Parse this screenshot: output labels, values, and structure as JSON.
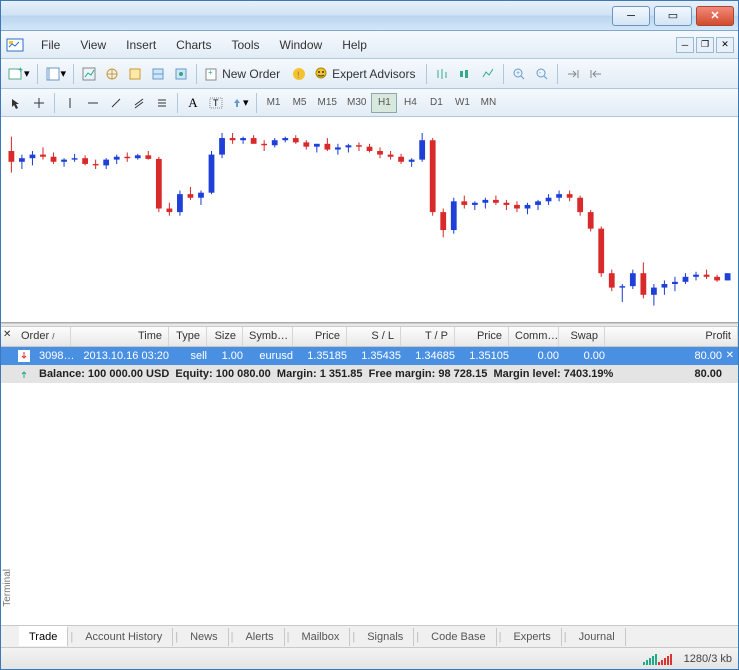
{
  "menu": {
    "file": "File",
    "view": "View",
    "insert": "Insert",
    "charts": "Charts",
    "tools": "Tools",
    "window": "Window",
    "help": "Help"
  },
  "toolbar": {
    "new_order": "New Order",
    "expert_advisors": "Expert Advisors"
  },
  "timeframes": [
    "M1",
    "M5",
    "M15",
    "M30",
    "H1",
    "H4",
    "D1",
    "W1",
    "MN"
  ],
  "active_timeframe": "H1",
  "terminal": {
    "label": "Terminal",
    "columns": {
      "order": "Order",
      "time": "Time",
      "type": "Type",
      "size": "Size",
      "symbol": "Symb…",
      "price": "Price",
      "sl": "S / L",
      "tp": "T / P",
      "price2": "Price",
      "comm": "Comm…",
      "swap": "Swap",
      "profit": "Profit"
    },
    "row": {
      "order": "3098…",
      "time": "2013.10.16 03:20",
      "type": "sell",
      "size": "1.00",
      "symbol": "eurusd",
      "price": "1.35185",
      "sl": "1.35435",
      "tp": "1.34685",
      "price2": "1.35105",
      "comm": "0.00",
      "swap": "0.00",
      "profit": "80.00"
    },
    "summary": {
      "balance_label": "Balance:",
      "balance": "100 000.00 USD",
      "equity_label": "Equity:",
      "equity": "100 080.00",
      "margin_label": "Margin:",
      "margin": "1 351.85",
      "free_margin_label": "Free margin:",
      "free_margin": "98 728.15",
      "margin_level_label": "Margin level:",
      "margin_level": "7403.19%",
      "profit": "80.00"
    },
    "tabs": [
      "Trade",
      "Account History",
      "News",
      "Alerts",
      "Mailbox",
      "Signals",
      "Code Base",
      "Experts",
      "Journal"
    ],
    "active_tab": "Trade"
  },
  "status": {
    "traffic": "1280/3 kb"
  },
  "chart_data": {
    "type": "candlestick",
    "timeframe": "H1",
    "symbol": "EURUSD",
    "candles": [
      {
        "o": 1.353,
        "h": 1.355,
        "l": 1.35,
        "c": 1.3515
      },
      {
        "o": 1.3515,
        "h": 1.3525,
        "l": 1.3505,
        "c": 1.352
      },
      {
        "o": 1.352,
        "h": 1.353,
        "l": 1.351,
        "c": 1.3525
      },
      {
        "o": 1.3525,
        "h": 1.3535,
        "l": 1.3518,
        "c": 1.3522
      },
      {
        "o": 1.3522,
        "h": 1.3528,
        "l": 1.3512,
        "c": 1.3515
      },
      {
        "o": 1.3515,
        "h": 1.352,
        "l": 1.3508,
        "c": 1.3518
      },
      {
        "o": 1.3518,
        "h": 1.3526,
        "l": 1.3515,
        "c": 1.352
      },
      {
        "o": 1.352,
        "h": 1.3524,
        "l": 1.351,
        "c": 1.3512
      },
      {
        "o": 1.3512,
        "h": 1.3518,
        "l": 1.3505,
        "c": 1.351
      },
      {
        "o": 1.351,
        "h": 1.352,
        "l": 1.3505,
        "c": 1.3518
      },
      {
        "o": 1.3518,
        "h": 1.3525,
        "l": 1.3512,
        "c": 1.3522
      },
      {
        "o": 1.3522,
        "h": 1.3528,
        "l": 1.3515,
        "c": 1.352
      },
      {
        "o": 1.352,
        "h": 1.3526,
        "l": 1.3518,
        "c": 1.3524
      },
      {
        "o": 1.3524,
        "h": 1.353,
        "l": 1.3518,
        "c": 1.3519
      },
      {
        "o": 1.3519,
        "h": 1.3522,
        "l": 1.3445,
        "c": 1.345
      },
      {
        "o": 1.345,
        "h": 1.3458,
        "l": 1.344,
        "c": 1.3445
      },
      {
        "o": 1.3445,
        "h": 1.3475,
        "l": 1.344,
        "c": 1.347
      },
      {
        "o": 1.347,
        "h": 1.348,
        "l": 1.3462,
        "c": 1.3465
      },
      {
        "o": 1.3465,
        "h": 1.3475,
        "l": 1.3455,
        "c": 1.3472
      },
      {
        "o": 1.3472,
        "h": 1.353,
        "l": 1.347,
        "c": 1.3525
      },
      {
        "o": 1.3525,
        "h": 1.3555,
        "l": 1.352,
        "c": 1.3548
      },
      {
        "o": 1.3548,
        "h": 1.3555,
        "l": 1.354,
        "c": 1.3545
      },
      {
        "o": 1.3545,
        "h": 1.355,
        "l": 1.354,
        "c": 1.3548
      },
      {
        "o": 1.3548,
        "h": 1.3552,
        "l": 1.3542,
        "c": 1.354
      },
      {
        "o": 1.354,
        "h": 1.3545,
        "l": 1.353,
        "c": 1.3538
      },
      {
        "o": 1.3538,
        "h": 1.3548,
        "l": 1.3535,
        "c": 1.3545
      },
      {
        "o": 1.3545,
        "h": 1.355,
        "l": 1.3542,
        "c": 1.3548
      },
      {
        "o": 1.3548,
        "h": 1.3552,
        "l": 1.354,
        "c": 1.3542
      },
      {
        "o": 1.3542,
        "h": 1.3545,
        "l": 1.3532,
        "c": 1.3536
      },
      {
        "o": 1.3536,
        "h": 1.354,
        "l": 1.3528,
        "c": 1.354
      },
      {
        "o": 1.354,
        "h": 1.3548,
        "l": 1.353,
        "c": 1.3532
      },
      {
        "o": 1.3532,
        "h": 1.354,
        "l": 1.3525,
        "c": 1.3535
      },
      {
        "o": 1.3535,
        "h": 1.354,
        "l": 1.3528,
        "c": 1.3538
      },
      {
        "o": 1.3538,
        "h": 1.3542,
        "l": 1.353,
        "c": 1.3536
      },
      {
        "o": 1.3536,
        "h": 1.354,
        "l": 1.3528,
        "c": 1.353
      },
      {
        "o": 1.353,
        "h": 1.3535,
        "l": 1.352,
        "c": 1.3525
      },
      {
        "o": 1.3525,
        "h": 1.353,
        "l": 1.3518,
        "c": 1.3522
      },
      {
        "o": 1.3522,
        "h": 1.3526,
        "l": 1.3512,
        "c": 1.3515
      },
      {
        "o": 1.3515,
        "h": 1.352,
        "l": 1.3508,
        "c": 1.3518
      },
      {
        "o": 1.3518,
        "h": 1.3555,
        "l": 1.3515,
        "c": 1.3545
      },
      {
        "o": 1.3545,
        "h": 1.3548,
        "l": 1.344,
        "c": 1.3445
      },
      {
        "o": 1.3445,
        "h": 1.345,
        "l": 1.341,
        "c": 1.342
      },
      {
        "o": 1.342,
        "h": 1.3465,
        "l": 1.3415,
        "c": 1.346
      },
      {
        "o": 1.346,
        "h": 1.3468,
        "l": 1.345,
        "c": 1.3455
      },
      {
        "o": 1.3455,
        "h": 1.346,
        "l": 1.3448,
        "c": 1.3458
      },
      {
        "o": 1.3458,
        "h": 1.3465,
        "l": 1.345,
        "c": 1.3462
      },
      {
        "o": 1.3462,
        "h": 1.3468,
        "l": 1.3455,
        "c": 1.3458
      },
      {
        "o": 1.3458,
        "h": 1.3462,
        "l": 1.3448,
        "c": 1.3455
      },
      {
        "o": 1.3455,
        "h": 1.346,
        "l": 1.3445,
        "c": 1.345
      },
      {
        "o": 1.345,
        "h": 1.3458,
        "l": 1.3442,
        "c": 1.3455
      },
      {
        "o": 1.3455,
        "h": 1.3462,
        "l": 1.3448,
        "c": 1.346
      },
      {
        "o": 1.346,
        "h": 1.347,
        "l": 1.3455,
        "c": 1.3465
      },
      {
        "o": 1.3465,
        "h": 1.3475,
        "l": 1.346,
        "c": 1.347
      },
      {
        "o": 1.347,
        "h": 1.3475,
        "l": 1.346,
        "c": 1.3465
      },
      {
        "o": 1.3465,
        "h": 1.3468,
        "l": 1.344,
        "c": 1.3445
      },
      {
        "o": 1.3445,
        "h": 1.3448,
        "l": 1.3418,
        "c": 1.3422
      },
      {
        "o": 1.3422,
        "h": 1.3425,
        "l": 1.3355,
        "c": 1.336
      },
      {
        "o": 1.336,
        "h": 1.3365,
        "l": 1.3335,
        "c": 1.334
      },
      {
        "o": 1.334,
        "h": 1.3345,
        "l": 1.332,
        "c": 1.3342
      },
      {
        "o": 1.3342,
        "h": 1.3365,
        "l": 1.3338,
        "c": 1.336
      },
      {
        "o": 1.336,
        "h": 1.3375,
        "l": 1.3325,
        "c": 1.333
      },
      {
        "o": 1.333,
        "h": 1.3345,
        "l": 1.3315,
        "c": 1.334
      },
      {
        "o": 1.334,
        "h": 1.335,
        "l": 1.333,
        "c": 1.3345
      },
      {
        "o": 1.3345,
        "h": 1.3355,
        "l": 1.3335,
        "c": 1.3348
      },
      {
        "o": 1.3348,
        "h": 1.336,
        "l": 1.3345,
        "c": 1.3355
      },
      {
        "o": 1.3355,
        "h": 1.3362,
        "l": 1.335,
        "c": 1.3358
      },
      {
        "o": 1.3358,
        "h": 1.3365,
        "l": 1.3352,
        "c": 1.3355
      },
      {
        "o": 1.3355,
        "h": 1.3358,
        "l": 1.3348,
        "c": 1.335
      },
      {
        "o": 1.335,
        "h": 1.336,
        "l": 1.335,
        "c": 1.336
      }
    ],
    "yrange": [
      1.33,
      1.357
    ]
  }
}
